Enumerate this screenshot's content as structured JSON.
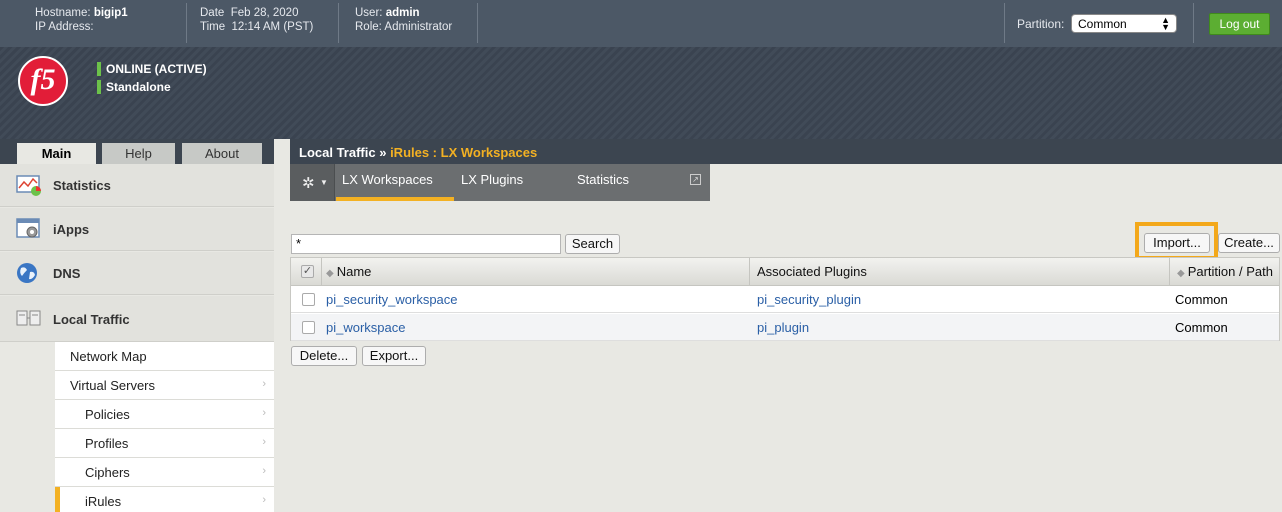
{
  "topbar": {
    "hostname_label": "Hostname:",
    "hostname": "bigip1",
    "ip_label": "IP Address:",
    "ip": "",
    "date_label": "Date",
    "date": "Feb 28, 2020",
    "time_label": "Time",
    "time": "12:14 AM (PST)",
    "user_label": "User:",
    "user": "admin",
    "role_label": "Role:",
    "role": "Administrator",
    "partition_label": "Partition:",
    "partition_value": "Common",
    "logout_label": "Log out"
  },
  "header": {
    "logo_text": "f5",
    "status_online": "ONLINE (ACTIVE)",
    "status_mode": "Standalone"
  },
  "sidebar": {
    "tabs": [
      {
        "label": "Main",
        "active": true
      },
      {
        "label": "Help",
        "active": false
      },
      {
        "label": "About",
        "active": false
      }
    ],
    "sections": [
      {
        "label": "Statistics",
        "icon": "statistics-chart-icon"
      },
      {
        "label": "iApps",
        "icon": "iapps-gear-window-icon"
      },
      {
        "label": "DNS",
        "icon": "globe-icon"
      },
      {
        "label": "Local Traffic",
        "icon": "local-traffic-network-icon"
      }
    ],
    "sub_items": [
      {
        "label": "Network Map",
        "arrow": false
      },
      {
        "label": "Virtual Servers",
        "arrow": true
      },
      {
        "label": "Policies",
        "arrow": true
      },
      {
        "label": "Profiles",
        "arrow": true
      },
      {
        "label": "Ciphers",
        "arrow": true
      },
      {
        "label": "iRules",
        "arrow": true
      }
    ]
  },
  "main": {
    "breadcrumb_root": "Local Traffic",
    "breadcrumb_sep": "»",
    "breadcrumb_current": "iRules : LX Workspaces",
    "tabs": [
      {
        "label": "LX Workspaces",
        "active": true
      },
      {
        "label": "LX Plugins",
        "active": false
      },
      {
        "label": "Statistics",
        "active": false
      }
    ],
    "search_value": "*",
    "search_button": "Search",
    "import_button": "Import...",
    "create_button": "Create...",
    "table": {
      "columns": [
        "Name",
        "Associated Plugins",
        "Partition / Path"
      ],
      "rows": [
        {
          "name": "pi_security_workspace",
          "plugin": "pi_security_plugin",
          "partition": "Common"
        },
        {
          "name": "pi_workspace",
          "plugin": "pi_plugin",
          "partition": "Common"
        }
      ]
    },
    "delete_button": "Delete...",
    "export_button": "Export..."
  },
  "colors": {
    "accent": "#f3b123",
    "logout": "#5cae32",
    "link": "#2a5fa6",
    "logo": "#e21d38"
  }
}
